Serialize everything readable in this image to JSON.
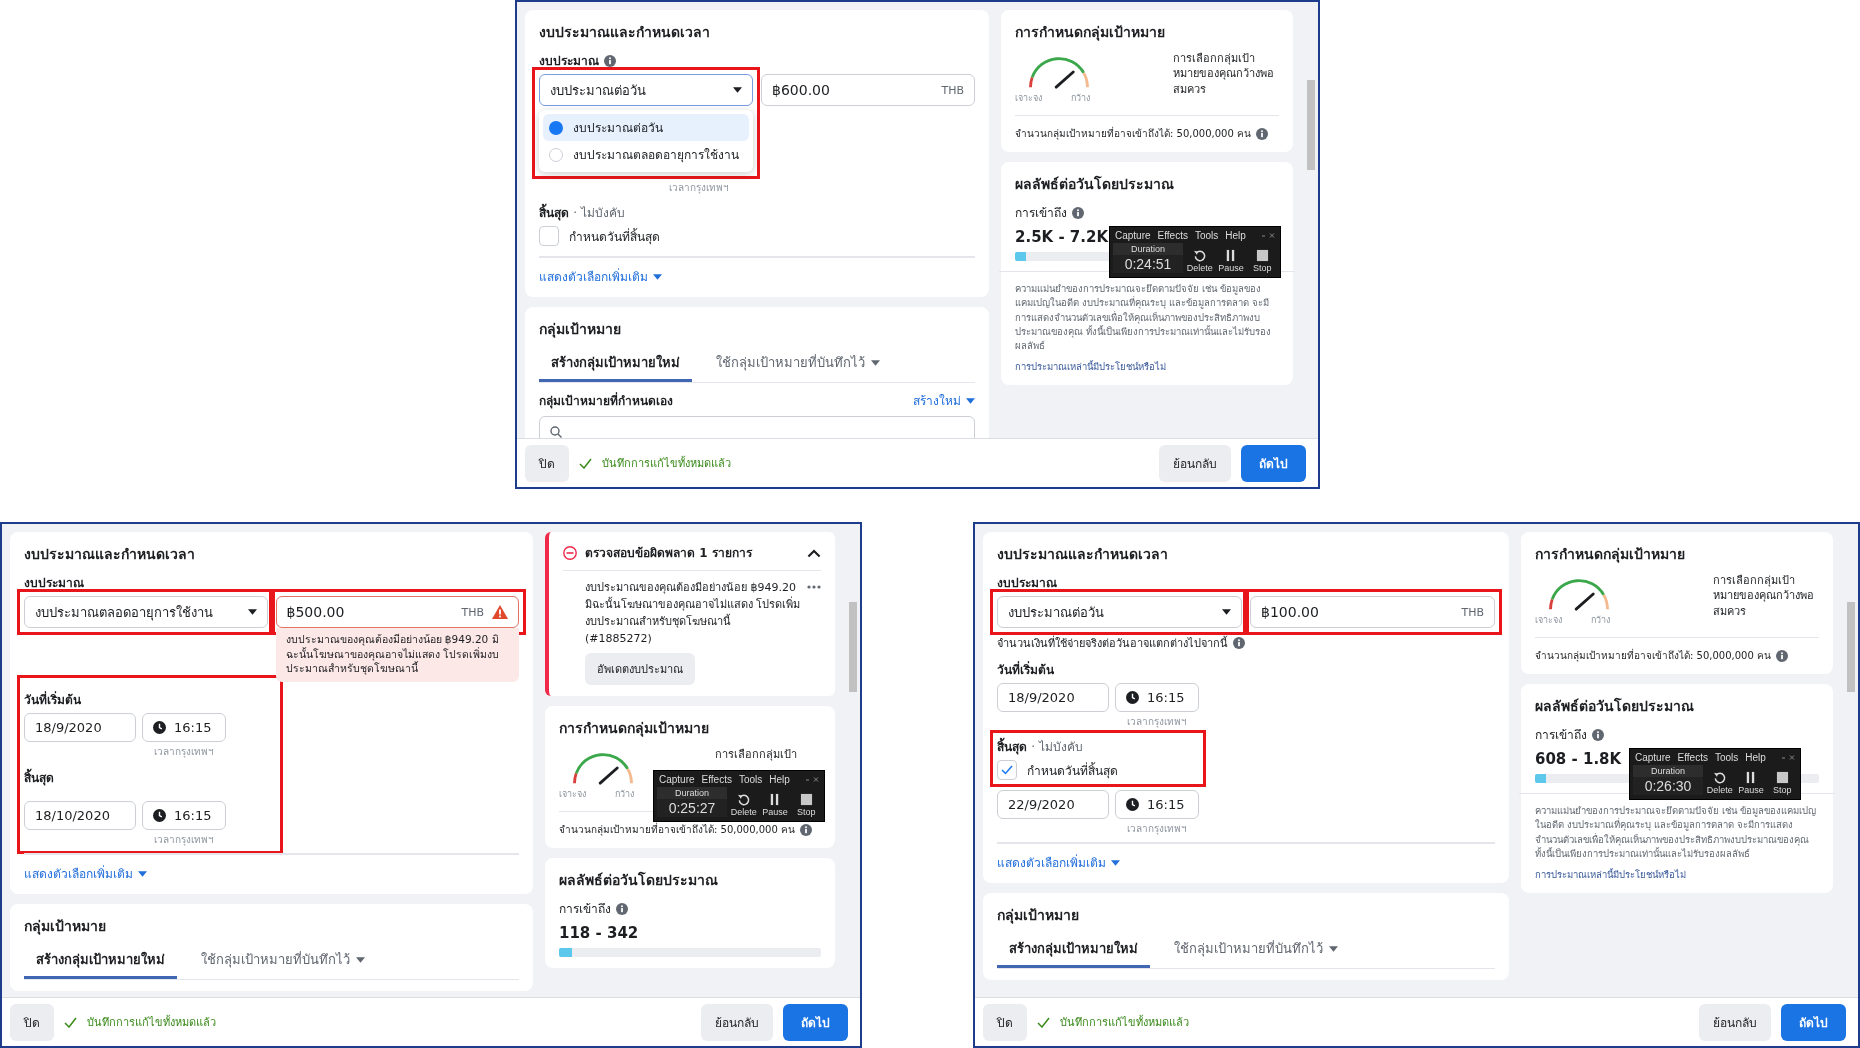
{
  "shots": [
    {
      "budget_card": {
        "title": "งบประมาณและกำหนดเวลา",
        "budget_label": "งบประมาณ",
        "budget_info": true,
        "budget_type": {
          "value": "งบประมาณต่อวัน",
          "highlight": true
        },
        "dropdown": [
          {
            "label": "งบประมาณต่อวัน",
            "selected": true
          },
          {
            "label": "งบประมาณตลอดอายุการใช้งาน",
            "selected": false
          }
        ],
        "amount": {
          "value": "฿600.00",
          "currency": "THB",
          "warning": false,
          "highlight": false
        },
        "schedule_highlight": false,
        "start": {
          "timezone": "เวลากรุงเทพฯ"
        },
        "end": {
          "label": "สิ้นสุด",
          "optional": "· ไม่บังคับ",
          "checkbox": {
            "label": "กำหนดวันที่สิ้นสุด",
            "checked": false,
            "highlight": false
          }
        },
        "more_options": "แสดงตัวเลือกเพิ่มเติม"
      },
      "audience_card": {
        "title": "กลุ่มเป้าหมาย",
        "tabs": [
          {
            "label": "สร้างกลุ่มเป้าหมายใหม่",
            "selected": true,
            "dropdown": false
          },
          {
            "label": "ใช้กลุ่มเป้าหมายที่บันทึกไว้",
            "selected": false,
            "dropdown": true
          }
        ],
        "custom": {
          "label": "กลุ่มเป้าหมายที่กำหนดเอง",
          "create": "สร้างใหม่"
        }
      },
      "targeting_card": {
        "title": "การกำหนดกลุ่มเป้าหมาย",
        "narrow": "เจาะจง",
        "broad": "กว้าง",
        "verdict": "การเลือกกลุ่มเป้าหมายของคุณกว้างพอสมควร",
        "reach": "จำนวนกลุ่มเป้าหมายที่อาจเข้าถึงได้: 50,000,000 คน"
      },
      "results_card": {
        "title": "ผลลัพธ์ต่อวันโดยประมาณ",
        "reach_label": "การเข้าถึง",
        "range": "2.5K - 7.2K",
        "level": 0.04,
        "disclaimer": "ความแม่นยำของการประมาณจะยึดตามปัจจัย เช่น ข้อมูลของแคมเปญในอดีต งบประมาณที่คุณระบุ และข้อมูลการตลาด จะมีการแสดงจำนวนตัวเลขเพื่อให้คุณเห็นภาพของประสิทธิภาพงบประมาณของคุณ ทั้งนี้เป็นเพียงการประมาณเท่านั้นและไม่รับรองผลลัพธ์",
        "link": "การประมาณเหล่านี้มีประโยชน์หรือไม่",
        "recorder": {
          "menu": [
            "Capture",
            "Effects",
            "Tools",
            "Help"
          ],
          "duration_label": "Duration",
          "time": "0:24:51",
          "actions": [
            {
              "kind": "delete",
              "label": "Delete"
            },
            {
              "kind": "pause",
              "label": "Pause"
            },
            {
              "kind": "stop",
              "label": "Stop"
            }
          ]
        }
      },
      "footer": {
        "close": "ปิด",
        "saved": "บันทึกการแก้ไขทั้งหมดแล้ว",
        "back": "ย้อนกลับ",
        "next": "ถัดไป"
      }
    },
    {
      "budget_card": {
        "title": "งบประมาณและกำหนดเวลา",
        "budget_label": "งบประมาณ",
        "budget_info": false,
        "budget_type": {
          "value": "งบประมาณตลอดอายุการใช้งาน",
          "highlight": true
        },
        "amount": {
          "value": "฿500.00",
          "currency": "THB",
          "warning": true,
          "highlight": true
        },
        "amount_error": "งบประมาณของคุณต้องมีอย่างน้อย ฿949.20 มิฉะนั้นโฆษณาของคุณอาจไม่แสดง โปรดเพิ่มงบประมาณสำหรับชุดโฆษณานี้",
        "schedule_highlight": true,
        "start": {
          "label": "วันที่เริ่มต้น",
          "date": "18/9/2020",
          "time": "16:15",
          "timezone": "เวลากรุงเทพฯ"
        },
        "end": {
          "label": "สิ้นสุด",
          "date": "18/10/2020",
          "time": "16:15",
          "timezone": "เวลากรุงเทพฯ"
        },
        "more_options": "แสดงตัวเลือกเพิ่มเติม"
      },
      "audience_card": {
        "title": "กลุ่มเป้าหมาย",
        "tabs": [
          {
            "label": "สร้างกลุ่มเป้าหมายใหม่",
            "selected": true,
            "dropdown": false
          },
          {
            "label": "ใช้กลุ่มเป้าหมายที่บันทึกไว้",
            "selected": false,
            "dropdown": true
          }
        ]
      },
      "error_card": {
        "title": "ตรวจสอบข้อผิดพลาด 1 รายการ",
        "message": "งบประมาณของคุณต้องมีอย่างน้อย ฿949.20 มิฉะนั้นโฆษณาของคุณอาจไม่แสดง โปรดเพิ่มงบประมาณสำหรับชุดโฆษณานี้ (#1885272)",
        "button": "อัพเดตงบประมาณ"
      },
      "targeting_card": {
        "title": "การกำหนดกลุ่มเป้าหมาย",
        "narrow": "เจาะจง",
        "broad": "กว้าง",
        "verdict": "การเลือกกลุ่มเป้า",
        "reach": "จำนวนกลุ่มเป้าหมายที่อาจเข้าถึงได้: 50,000,000 คน",
        "recorder": {
          "menu": [
            "Capture",
            "Effects",
            "Tools",
            "Help"
          ],
          "duration_label": "Duration",
          "time": "0:25:27",
          "actions": [
            {
              "kind": "delete",
              "label": "Delete"
            },
            {
              "kind": "pause",
              "label": "Pause"
            },
            {
              "kind": "stop",
              "label": "Stop"
            }
          ]
        }
      },
      "results_card": {
        "title": "ผลลัพธ์ต่อวันโดยประมาณ",
        "reach_label": "การเข้าถึง",
        "range": "118 - 342",
        "level": 0.05
      },
      "footer": {
        "close": "ปิด",
        "saved": "บันทึกการแก้ไขทั้งหมดแล้ว",
        "back": "ย้อนกลับ",
        "next": "ถัดไป"
      }
    },
    {
      "budget_card": {
        "title": "งบประมาณและกำหนดเวลา",
        "budget_label": "งบประมาณ",
        "budget_info": false,
        "budget_type": {
          "value": "งบประมาณต่อวัน",
          "highlight": true
        },
        "amount": {
          "value": "฿100.00",
          "currency": "THB",
          "warning": false,
          "highlight": true
        },
        "spend_note": "จำนวนเงินที่ใช้จ่ายจริงต่อวันอาจแตกต่างไปจากนี้",
        "schedule_highlight": false,
        "start": {
          "label": "วันที่เริ่มต้น",
          "date": "18/9/2020",
          "time": "16:15",
          "timezone": "เวลากรุงเทพฯ"
        },
        "end": {
          "label": "สิ้นสุด",
          "optional": "· ไม่บังคับ",
          "checkbox": {
            "label": "กำหนดวันที่สิ้นสุด",
            "checked": true,
            "highlight": true
          },
          "date": "22/9/2020",
          "time": "16:15",
          "timezone": "เวลากรุงเทพฯ"
        },
        "more_options": "แสดงตัวเลือกเพิ่มเติม"
      },
      "audience_card": {
        "title": "กลุ่มเป้าหมาย",
        "tabs": [
          {
            "label": "สร้างกลุ่มเป้าหมายใหม่",
            "selected": true,
            "dropdown": false
          },
          {
            "label": "ใช้กลุ่มเป้าหมายที่บันทึกไว้",
            "selected": false,
            "dropdown": true
          }
        ]
      },
      "targeting_card": {
        "title": "การกำหนดกลุ่มเป้าหมาย",
        "narrow": "เจาะจง",
        "broad": "กว้าง",
        "verdict": "การเลือกกลุ่มเป้าหมายของคุณกว้างพอสมควร",
        "reach": "จำนวนกลุ่มเป้าหมายที่อาจเข้าถึงได้: 50,000,000 คน"
      },
      "results_card": {
        "title": "ผลลัพธ์ต่อวันโดยประมาณ",
        "reach_label": "การเข้าถึง",
        "range": "608 - 1.8K",
        "level": 0.04,
        "disclaimer": "ความแม่นยำของการประมาณจะยึดตามปัจจัย เช่น ข้อมูลของแคมเปญในอดีต งบประมาณที่คุณระบุ และข้อมูลการตลาด จะมีการแสดงจำนวนตัวเลขเพื่อให้คุณเห็นภาพของประสิทธิภาพงบประมาณของคุณ ทั้งนี้เป็นเพียงการประมาณเท่านั้นและไม่รับรองผลลัพธ์",
        "link": "การประมาณเหล่านี้มีประโยชน์หรือไม่",
        "recorder": {
          "menu": [
            "Capture",
            "Effects",
            "Tools",
            "Help"
          ],
          "duration_label": "Duration",
          "time": "0:26:30",
          "actions": [
            {
              "kind": "delete",
              "label": "Delete"
            },
            {
              "kind": "pause",
              "label": "Pause"
            },
            {
              "kind": "stop",
              "label": "Stop"
            }
          ]
        }
      },
      "footer": {
        "close": "ปิด",
        "saved": "บันทึกการแก้ไขทั้งหมดแล้ว",
        "back": "ย้อนกลับ",
        "next": "ถัดไป"
      }
    }
  ]
}
